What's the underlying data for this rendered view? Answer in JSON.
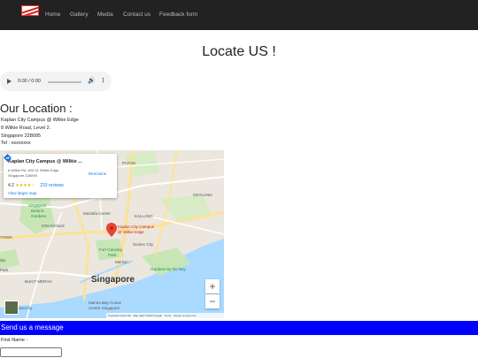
{
  "nav": {
    "items": [
      "Home",
      "Gallery",
      "Media",
      "Contact us",
      "Feedback form"
    ]
  },
  "page": {
    "title": "Locate US !"
  },
  "audio": {
    "time": "0:00 / 0:00"
  },
  "location": {
    "title": "Our Location :",
    "lines": [
      "Kaplan City Campus @ Wilkie Edge",
      "8 Wilkie Road, Level 2.",
      "Singapore 228095",
      "Tel : xxxxxxxx"
    ]
  },
  "map": {
    "card_title": "Kaplan City Campus @ Wilkie ...",
    "card_address": [
      "8 Wilkie Rd, #02-01 Wilkie Edge,",
      "Singapore 228095"
    ],
    "rating": "4.2",
    "stars": "★★★★☆",
    "reviews": "233 reviews",
    "larger_map": "View larger map",
    "directions": "Directions",
    "marker_label": [
      "Kaplan City Campus",
      "@ Wilkie Edge"
    ],
    "labels": {
      "payoh": "PAYOH",
      "geylang": "GEYLANG",
      "mustafa": "Mustafa Centre",
      "botanic": [
        "Singapore",
        "Botanic",
        "Gardens"
      ],
      "ion": "ION Orchard",
      "town": "TOWN",
      "kallang": "KALLANG",
      "suntec": "Suntec City",
      "fort_canning": [
        "Fort Canning",
        "Park"
      ],
      "merlion": "Merlion",
      "bukit_merah": "BUKIT MERAH",
      "singapore": "Singapore",
      "gardens_bay": "Gardens by the Bay",
      "marina": [
        "Marina Bay Cruise",
        "Centre Singapore"
      ],
      "vivocity": "VivoCity",
      "dia": "dia",
      "park": "Park"
    },
    "zoom_in": "+",
    "zoom_out": "−",
    "attribution": [
      "Keyboard shortcuts",
      "Map data ©2023 Google",
      "Terms",
      "Report a map error"
    ]
  },
  "form": {
    "header": "Send us a message",
    "first_name_label": "First Name :"
  },
  "colors": {
    "navbar": "#222222",
    "message_bar": "#0000ff",
    "link": "#1a73e8"
  }
}
